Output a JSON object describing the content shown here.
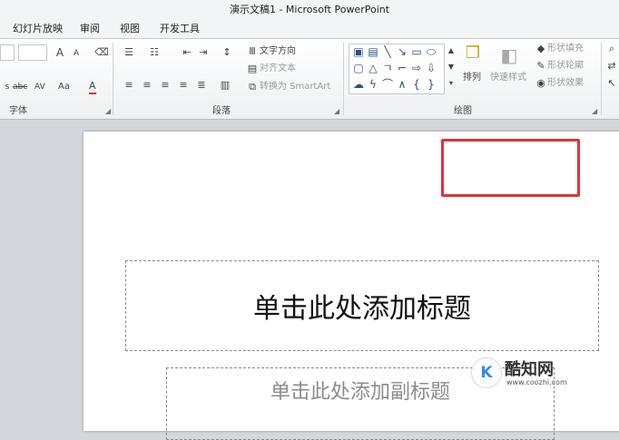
{
  "window": {
    "title": "演示文稿1 - Microsoft PowerPoint"
  },
  "tabs": [
    {
      "label": "幻灯片放映"
    },
    {
      "label": "审阅"
    },
    {
      "label": "视图"
    },
    {
      "label": "开发工具"
    }
  ],
  "ribbon": {
    "font_group": {
      "label": "字体",
      "grow_font": "A",
      "shrink_font": "A",
      "strikethrough": "abc",
      "spacing": "AV",
      "change_case": "Aa",
      "font_color": "A"
    },
    "paragraph_group": {
      "label": "段落",
      "text_direction": "文字方向",
      "align_text": "对齐文本",
      "convert_smartart": "转换为 SmartArt"
    },
    "drawing_group": {
      "label": "绘图",
      "arrange": "排列",
      "quick_styles": "快速样式",
      "shape_fill": "形状填充",
      "shape_outline": "形状轮廓",
      "shape_effects": "形状效果"
    }
  },
  "slide": {
    "title_placeholder": "单击此处添加标题",
    "subtitle_placeholder": "单击此处添加副标题"
  },
  "watermark": {
    "logo": "K",
    "name": "酷知网",
    "url": "www.coozhi.com"
  },
  "colors": {
    "highlight_border": "#d9363e",
    "accent_blue": "#2b4f8a"
  }
}
